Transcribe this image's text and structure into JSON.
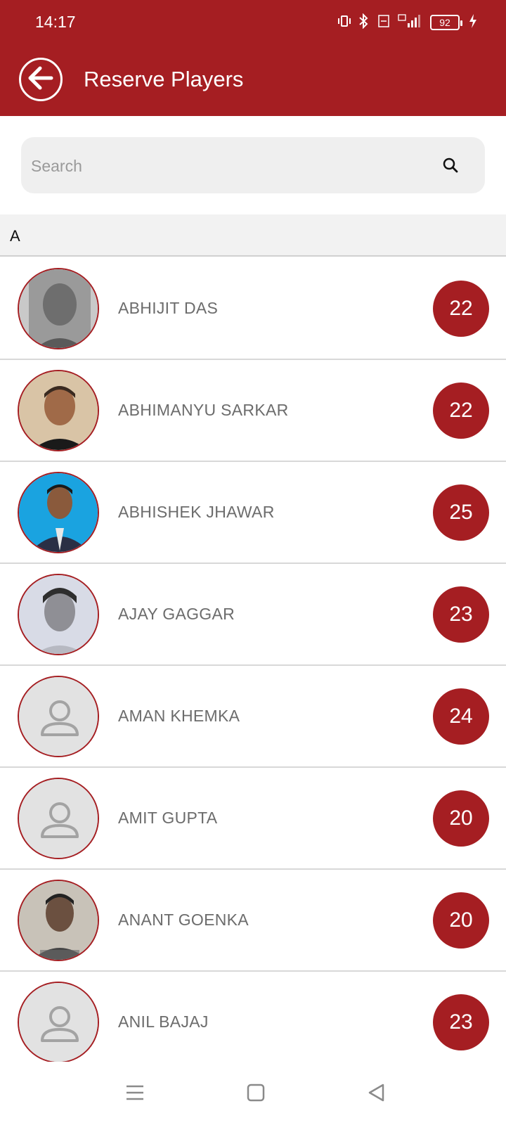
{
  "status_bar": {
    "time": "14:17",
    "battery": "92",
    "icons": [
      "vibrate-icon",
      "bluetooth-icon",
      "volte-icon",
      "4g-signal-icon",
      "battery-icon",
      "charging-icon"
    ]
  },
  "header": {
    "title": "Reserve Players",
    "back_icon": "arrow-left-circle-icon"
  },
  "search": {
    "placeholder": "Search",
    "value": "",
    "icon": "search-icon"
  },
  "section": {
    "letter": "A"
  },
  "players": [
    {
      "name": "ABHIJIT DAS",
      "number": "22",
      "avatar": "photo-grayscale"
    },
    {
      "name": "ABHIMANYU SARKAR",
      "number": "22",
      "avatar": "photo-beige"
    },
    {
      "name": "ABHISHEK JHAWAR",
      "number": "25",
      "avatar": "photo-blue"
    },
    {
      "name": "AJAY GAGGAR",
      "number": "23",
      "avatar": "photo-gray"
    },
    {
      "name": "AMAN KHEMKA",
      "number": "24",
      "avatar": "placeholder-person-icon"
    },
    {
      "name": "AMIT GUPTA",
      "number": "20",
      "avatar": "placeholder-person-icon"
    },
    {
      "name": "ANANT GOENKA",
      "number": "20",
      "avatar": "photo-light"
    },
    {
      "name": "ANIL BAJAJ",
      "number": "23",
      "avatar": "placeholder-person-icon"
    }
  ],
  "nav_bar": {
    "items": [
      "menu-icon",
      "home-square-icon",
      "back-triangle-icon"
    ]
  },
  "colors": {
    "primary": "#a51e22",
    "background": "#ffffff",
    "search_bg": "#efefef",
    "section_bg": "#f2f2f2",
    "name_text": "#6c6c6c"
  }
}
